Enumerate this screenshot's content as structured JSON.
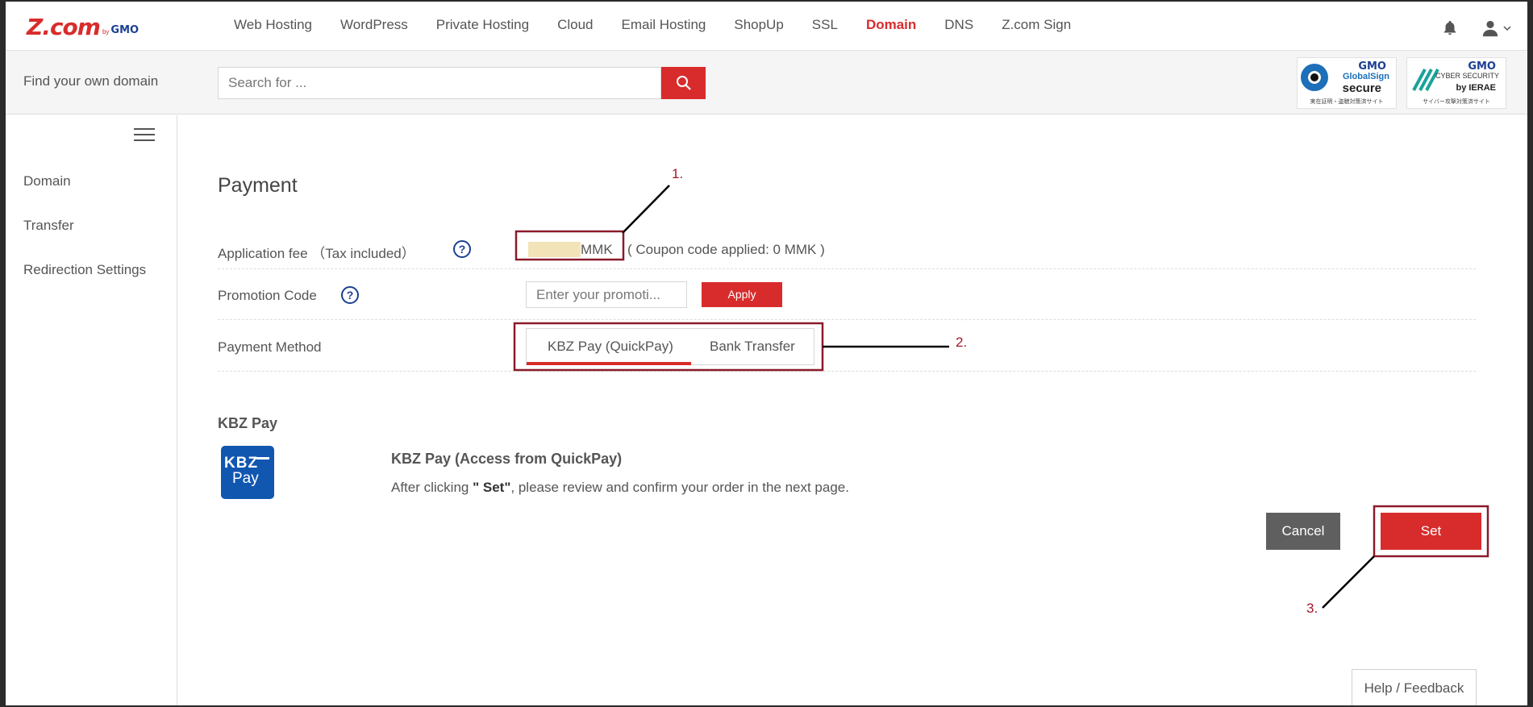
{
  "brand": {
    "logo_main": "Z.com",
    "logo_by": "by",
    "logo_gmo": "GMO"
  },
  "nav": {
    "links": [
      "Web Hosting",
      "WordPress",
      "Private Hosting",
      "Cloud",
      "Email Hosting",
      "ShopUp",
      "SSL",
      "Domain",
      "DNS",
      "Z.com Sign"
    ],
    "active": "Domain",
    "accent_color": "#d82c2c"
  },
  "search": {
    "label": "Find your own domain",
    "placeholder": "Search for ..."
  },
  "badges": {
    "globalsign": {
      "gmo": "GMO",
      "line2": "GlobalSign",
      "line3": "secure",
      "sub": "実在証明・盗聴対策済サイト"
    },
    "cybersecurity": {
      "gmo": "GMO",
      "line2": "CYBER SECURITY",
      "line3": "by IERAE",
      "sub": "サイバー攻撃対策済サイト"
    }
  },
  "sidebar": {
    "items": [
      "Domain",
      "Transfer",
      "Redirection Settings"
    ]
  },
  "payment": {
    "title": "Payment",
    "fee_label": "Application fee （Tax included）",
    "fee_unit": "MMK",
    "coupon_text": "( Coupon code applied:   0 MMK )",
    "promo_label": "Promotion Code",
    "promo_placeholder": "Enter your promoti...",
    "apply_label": "Apply",
    "method_label": "Payment Method",
    "tabs": [
      "KBZ Pay (QuickPay)",
      "Bank Transfer"
    ],
    "selected_tab": "KBZ Pay (QuickPay)"
  },
  "kbz": {
    "section_title": "KBZ Pay",
    "logo_top": "KBZ",
    "logo_bottom": "Pay",
    "heading": "KBZ Pay (Access from QuickPay)",
    "desc_before": "After clicking ",
    "desc_bold": "\" Set\"",
    "desc_after": ", please review and confirm your order in the next page."
  },
  "actions": {
    "cancel": "Cancel",
    "set": "Set"
  },
  "footer": {
    "help": "Help / Feedback"
  },
  "annotations": {
    "labels": [
      "1.",
      "2.",
      "3."
    ],
    "color": "#a1182c"
  }
}
